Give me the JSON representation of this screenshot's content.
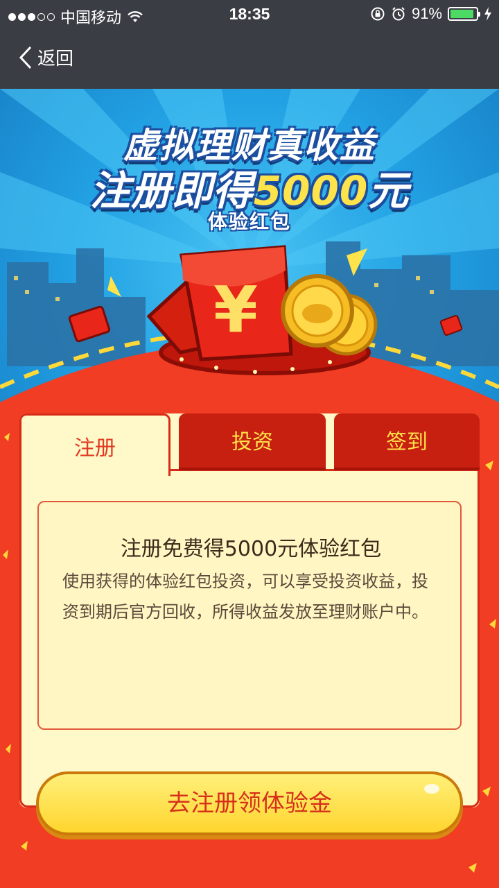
{
  "status_bar": {
    "carrier": "中国移动",
    "time": "18:35",
    "battery": "91%",
    "battery_level": 0.91
  },
  "nav": {
    "back_label": "返回"
  },
  "banner": {
    "line1": "虚拟理财真收益",
    "line2_prefix": "注册即得",
    "line2_amount": "5000",
    "line2_suffix": "元",
    "line3": "体验红包",
    "yuan_symbol": "¥"
  },
  "tabs": [
    {
      "label": "注册",
      "active": true
    },
    {
      "label": "投资",
      "active": false
    },
    {
      "label": "签到",
      "active": false
    }
  ],
  "info": {
    "title": "注册免费得5000元体验红包",
    "body": "使用获得的体验红包投资，可以享受投资收益，投资到期后官方回收，所得收益发放至理财账户中。"
  },
  "cta_label": "去注册领体验金",
  "colors": {
    "accent_red": "#f03d23",
    "tab_red": "#c71f10",
    "gold": "#ffe24a",
    "nav_bg": "#3b3d44",
    "sky": "#22a2e4"
  }
}
